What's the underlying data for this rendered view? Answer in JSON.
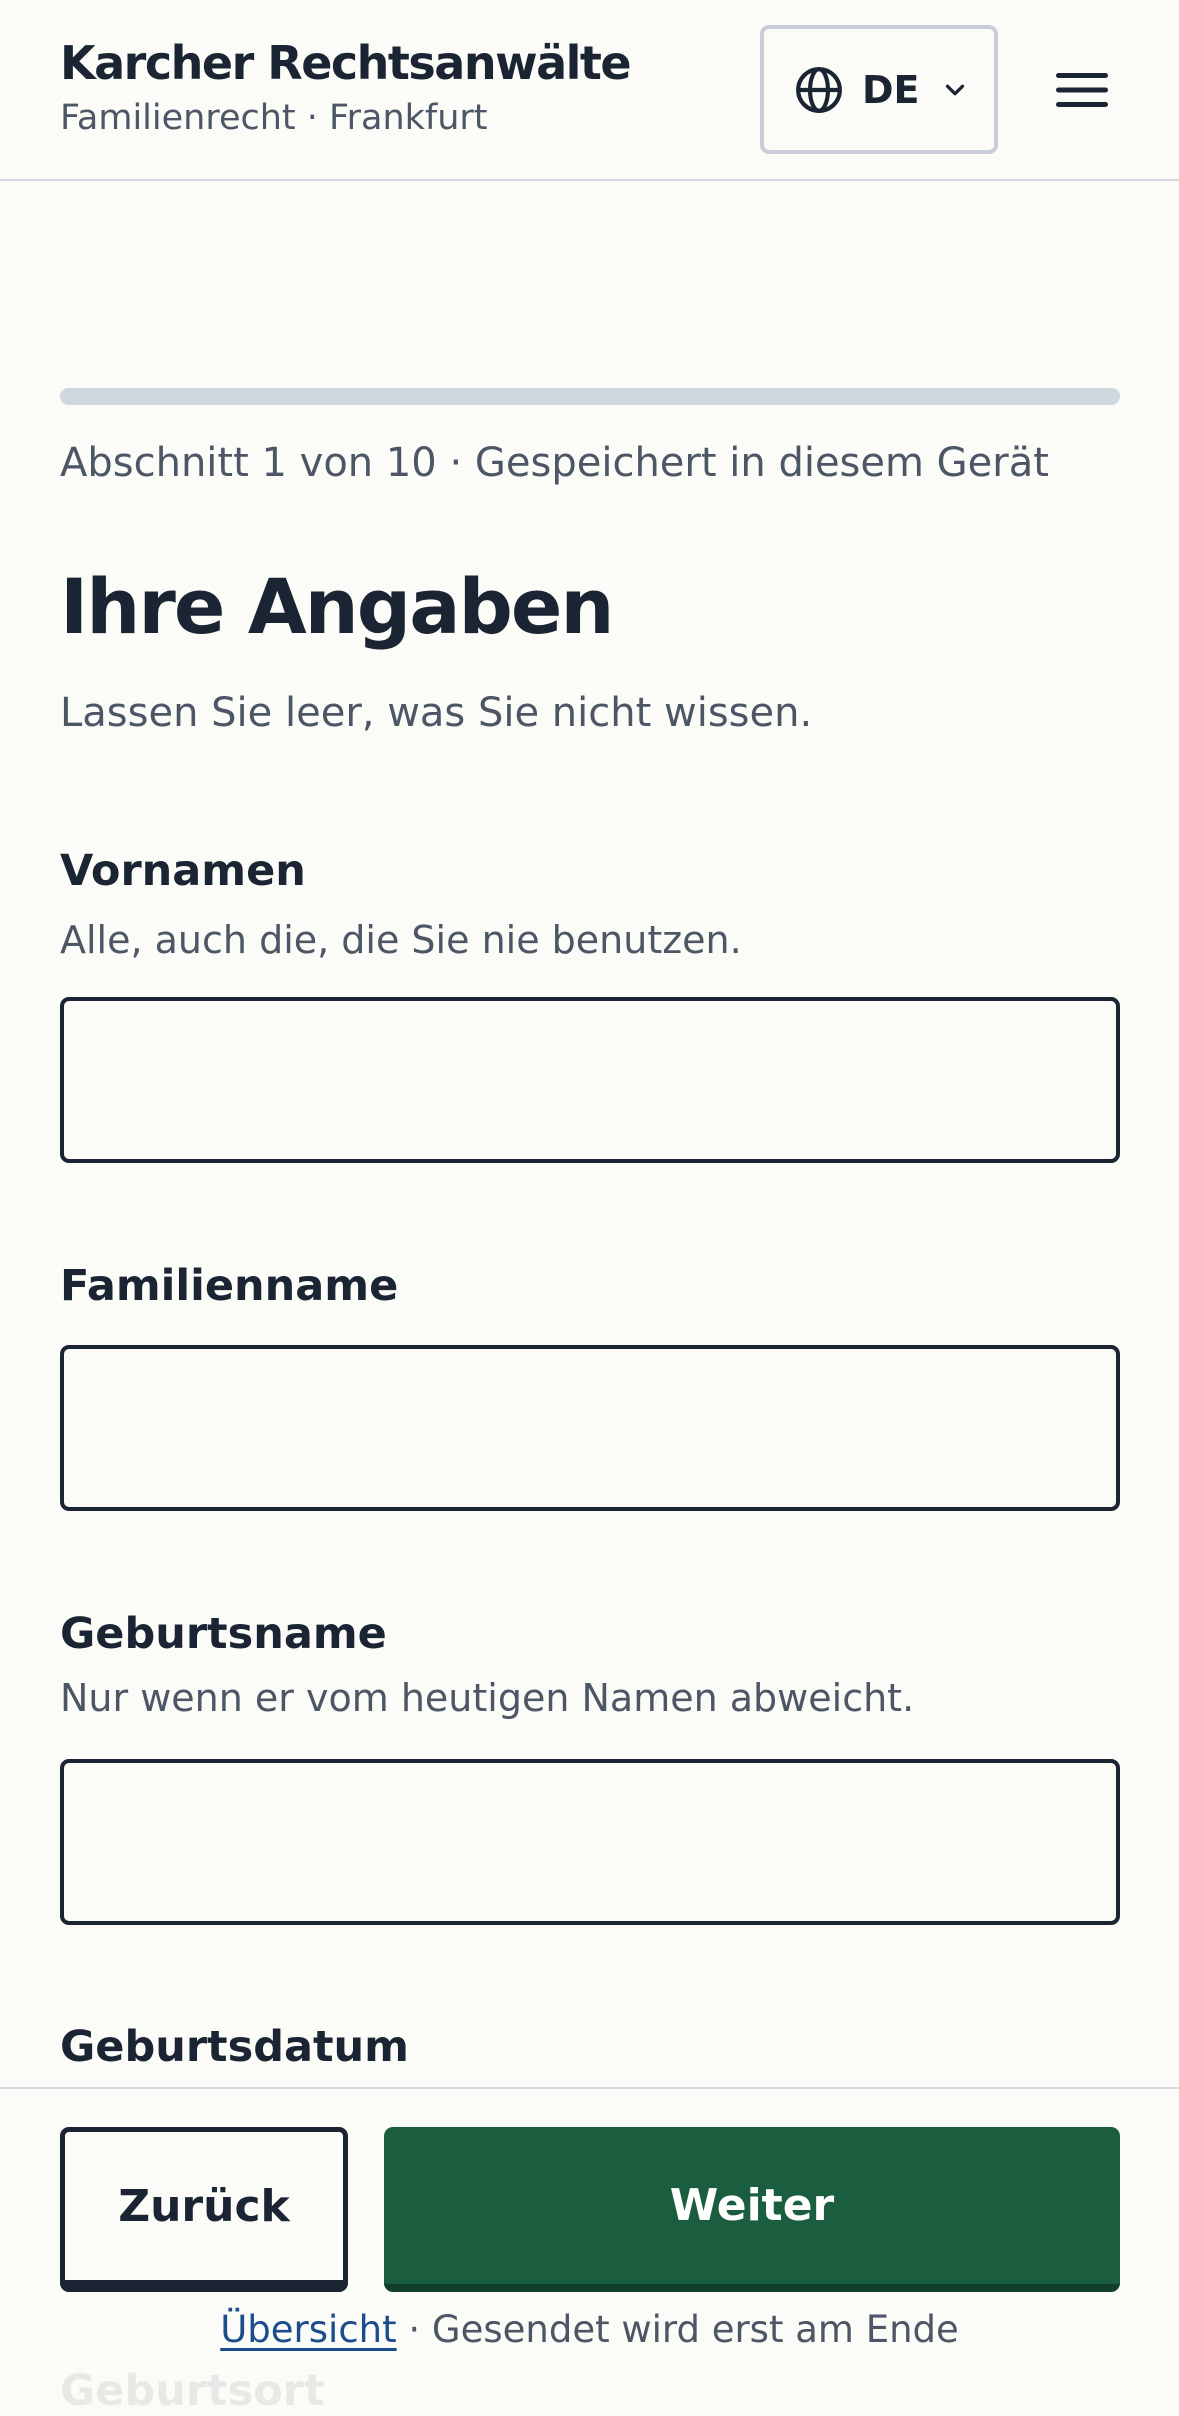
{
  "header": {
    "title": "Karcher Rechtsanwälte",
    "subtitle": "Familienrecht · Frankfurt",
    "language_button": {
      "label": "DE",
      "icon": "globe-icon",
      "dropdown_icon": "chevron-down-icon"
    },
    "menu_icon": "hamburger-menu-icon"
  },
  "progress": {
    "fraction_complete": 0,
    "text": "Abschnitt 1 von 10 · Gespeichert in diesem Gerät"
  },
  "page": {
    "title": "Ihre Angaben",
    "intro": "Lassen Sie leer, was Sie nicht wissen."
  },
  "fields": [
    {
      "label": "Vornamen",
      "hint": "Alle, auch die, die Sie nie benutzen.",
      "value": ""
    },
    {
      "label": "Familienname",
      "hint": "",
      "value": ""
    },
    {
      "label": "Geburtsname",
      "hint": "Nur wenn er vom heutigen Namen abweicht.",
      "value": ""
    },
    {
      "label": "Geburtsdatum",
      "hint": "",
      "value": ""
    }
  ],
  "actions": {
    "back_label": "Zurück",
    "next_label": "Weiter"
  },
  "footer": {
    "link_label": "Übersicht",
    "note": " · Gesendet wird erst am Ende"
  },
  "colors": {
    "primary": "#1b5e3f",
    "text": "#1b2433",
    "muted": "#4c5665",
    "link": "#1b4d8c",
    "background": "#fbfbf8"
  }
}
